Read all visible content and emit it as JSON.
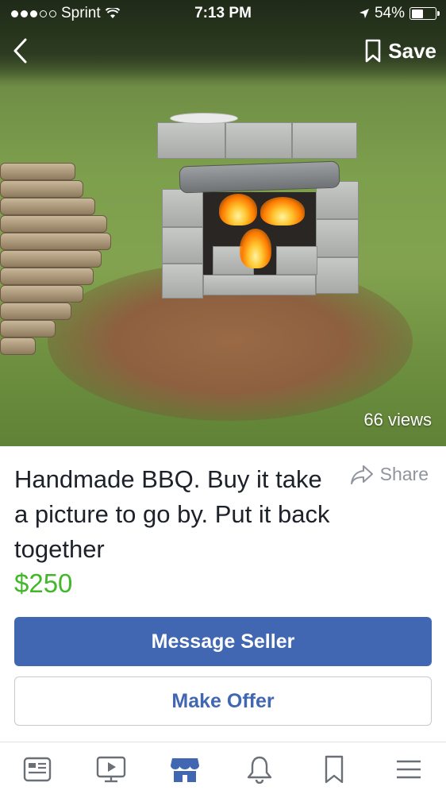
{
  "status_bar": {
    "carrier": "Sprint",
    "time": "7:13 PM",
    "battery_percent": "54%",
    "battery_level": 0.54
  },
  "header": {
    "save_label": "Save"
  },
  "photo": {
    "views_label": "66 views"
  },
  "listing": {
    "title": "Handmade BBQ.  Buy it take a picture to go by. Put it back together",
    "price": "$250",
    "share_label": "Share"
  },
  "actions": {
    "message_seller": "Message Seller",
    "make_offer": "Make Offer"
  },
  "tab_bar": {
    "tabs": [
      {
        "icon": "news-feed-icon",
        "active": false
      },
      {
        "icon": "watch-icon",
        "active": false
      },
      {
        "icon": "marketplace-icon",
        "active": true
      },
      {
        "icon": "notifications-icon",
        "active": false
      },
      {
        "icon": "saved-icon",
        "active": false
      },
      {
        "icon": "menu-icon",
        "active": false
      }
    ]
  },
  "colors": {
    "accent": "#4267b2",
    "price": "#42b72a",
    "inactive_icon": "#6b6f76",
    "active_icon": "#4267b2"
  }
}
